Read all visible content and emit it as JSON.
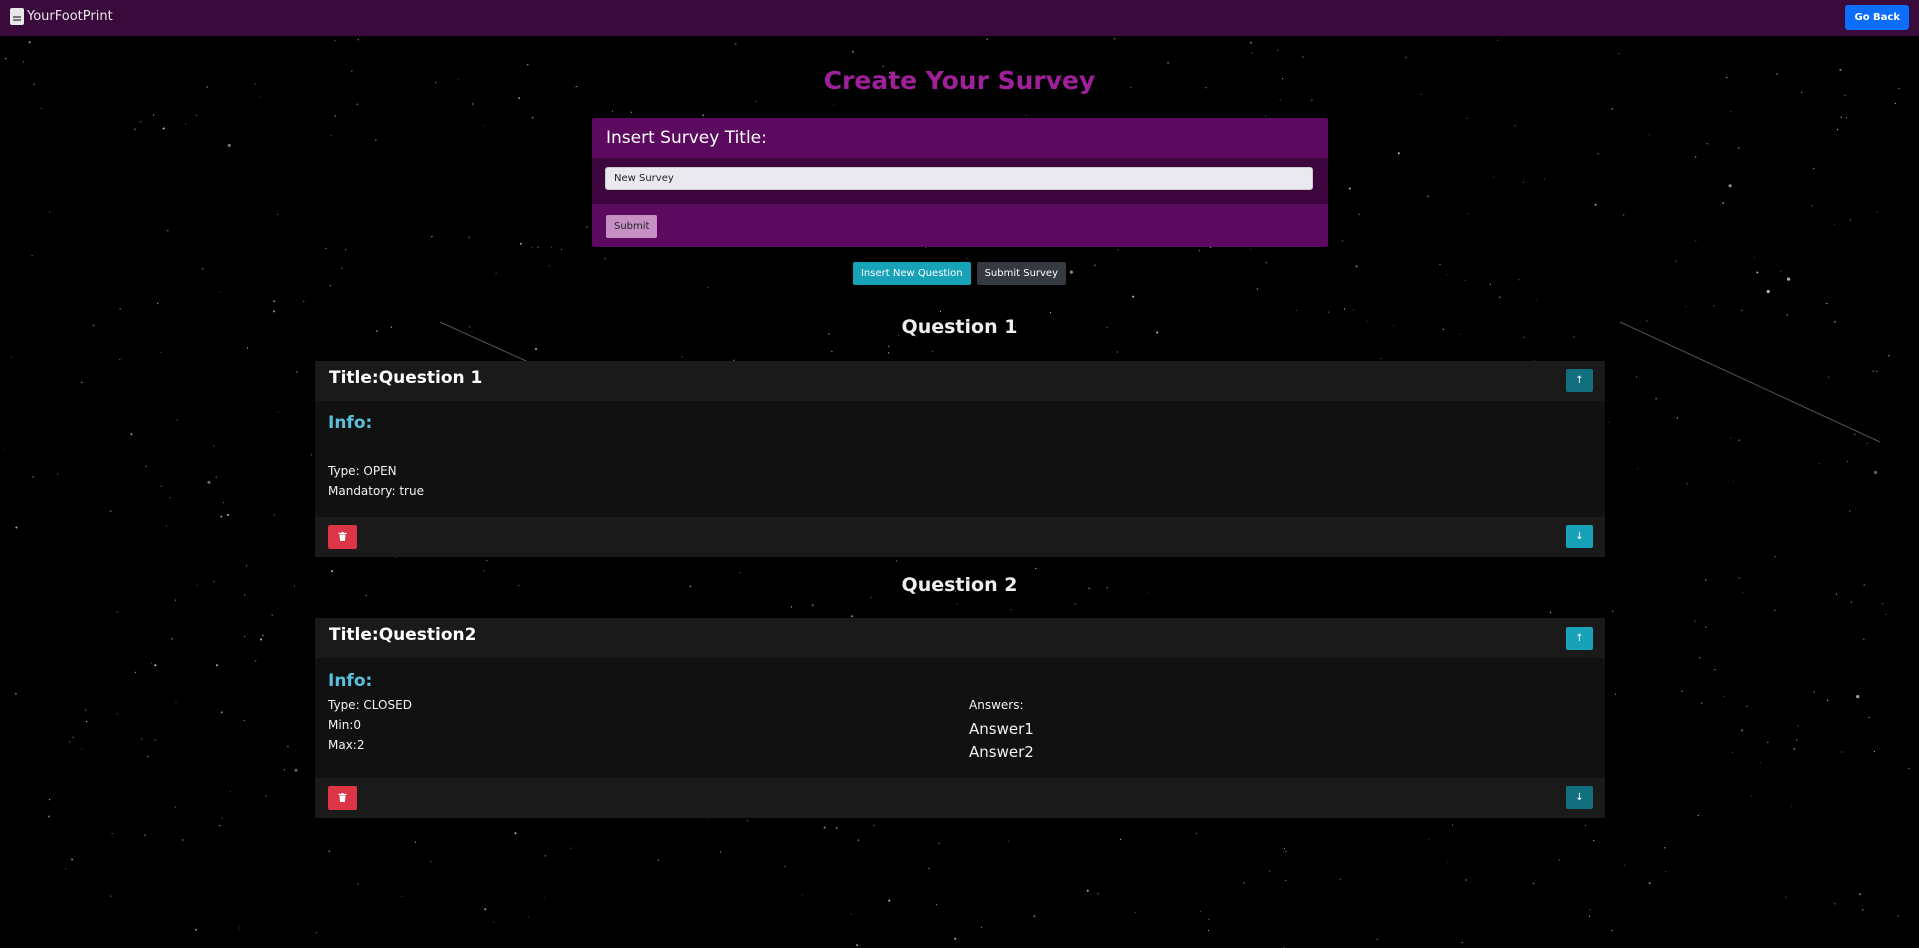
{
  "navbar": {
    "brand": "YourFootPrint",
    "go_back_label": "Go Back"
  },
  "page": {
    "title": "Create Your Survey"
  },
  "survey_title_card": {
    "header": "Insert Survey Title:",
    "input_value": "New Survey",
    "submit_label": "Submit"
  },
  "actions": {
    "insert_question_label": "Insert New Question",
    "submit_survey_label": "Submit Survey"
  },
  "questions": [
    {
      "heading": "Question 1",
      "title": "Title:Question 1",
      "info_label": "Info:",
      "type": "Type: OPEN",
      "mandatory": "Mandatory: true"
    },
    {
      "heading": "Question 2",
      "title": "Title:Question2",
      "info_label": "Info:",
      "type": "Type: CLOSED",
      "min": "Min:0",
      "max": "Max:2",
      "answers_label": "Answers:",
      "answers": [
        "Answer1",
        "Answer2"
      ]
    }
  ],
  "icons": {
    "up": "↑",
    "down": "↓",
    "trash": "trash-icon"
  },
  "colors": {
    "navbar": "#3a0a3c",
    "title_accent": "#a0209a",
    "card_purple": "#5b0a5f",
    "teal": "#17a2b8",
    "danger": "#dc3545",
    "primary": "#0d6efd",
    "info_blue": "#5bc0de"
  }
}
